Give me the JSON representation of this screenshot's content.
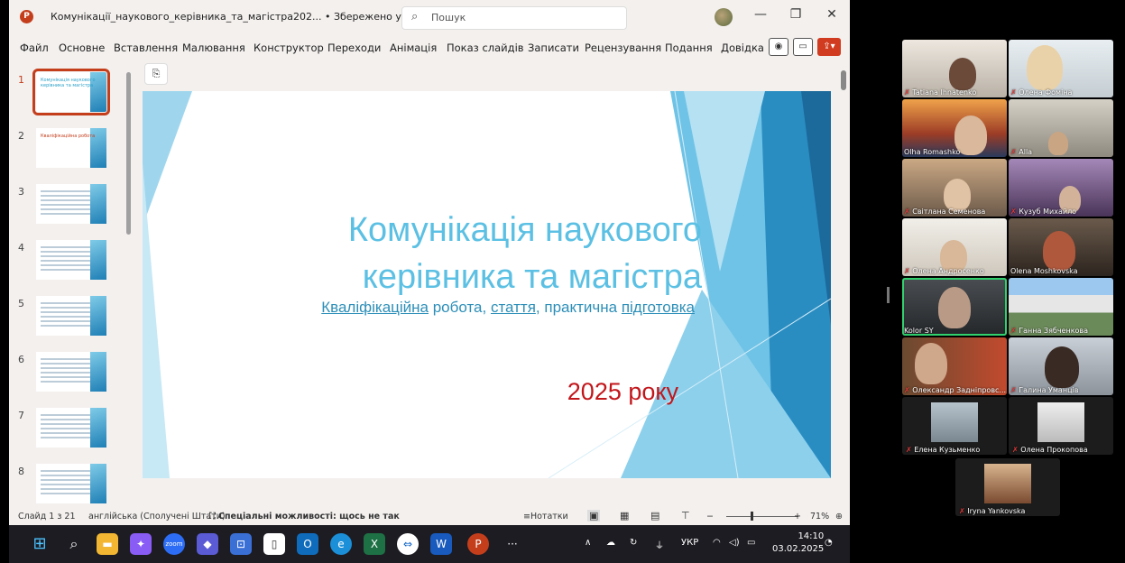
{
  "app": {
    "logo_letter": "P",
    "doc_title": "Комунікації_наукового_керівника_та_магістра202...",
    "save_status": "• Збережено у цей ПК",
    "search_placeholder": "Пошук"
  },
  "window_controls": {
    "minimize": "—",
    "restore": "❐",
    "close": "✕"
  },
  "ribbon": {
    "tabs": [
      "Файл",
      "Основне",
      "Вставлення",
      "Малювання",
      "Конструктор",
      "Переходи",
      "Анімація",
      "Показ слайдів",
      "Записати",
      "Рецензування",
      "Подання",
      "Довідка"
    ]
  },
  "thumbnails": [
    {
      "num": "1",
      "title": "Комунікація наукового керівника та магістра"
    },
    {
      "num": "2",
      "title": "Кваліфікаційна робота"
    },
    {
      "num": "3",
      "title": ""
    },
    {
      "num": "4",
      "title": ""
    },
    {
      "num": "5",
      "title": ""
    },
    {
      "num": "6",
      "title": ""
    },
    {
      "num": "7",
      "title": ""
    },
    {
      "num": "8",
      "title": ""
    }
  ],
  "slide": {
    "title_line1": "Комунікація наукового",
    "title_line2": "керівника та магістра",
    "subtitle_parts": [
      "Кваліфікаційна",
      " робота, ",
      "стаття",
      ", практична ",
      "підготовка"
    ],
    "year": "2025 року",
    "colors": {
      "title": "#5bc0e3",
      "year": "#c2161b",
      "accent": "#2d8fb8"
    }
  },
  "status": {
    "slide_info": "Слайд 1 з 21",
    "language": "англійська (Сполучені Штати)",
    "accessibility": "Спеціальні можливості: щось не так",
    "notes": "Нотатки",
    "zoom": "71%"
  },
  "taskbar": {
    "tray_lang": "УКР",
    "time": "14:10",
    "date": "03.02.2025"
  },
  "participants": [
    {
      "name": "Tatiana Ihnatenko"
    },
    {
      "name": "Олена Фоміна"
    },
    {
      "name": "Olha Romashko"
    },
    {
      "name": "Alla"
    },
    {
      "name": "Світлана Семенова"
    },
    {
      "name": "Кузуб Михайло"
    },
    {
      "name": "Олена Андросенко"
    },
    {
      "name": "Olena Moshkovska"
    },
    {
      "name": "Kolor SY"
    },
    {
      "name": "Ганна Зябченкова"
    },
    {
      "name": "Олександр Задніпровс..."
    },
    {
      "name": "Галина Уманців"
    },
    {
      "name": "Елена Кузьменко"
    },
    {
      "name": "Олена Прокопова"
    },
    {
      "name": "Iryna Yankovska"
    }
  ]
}
